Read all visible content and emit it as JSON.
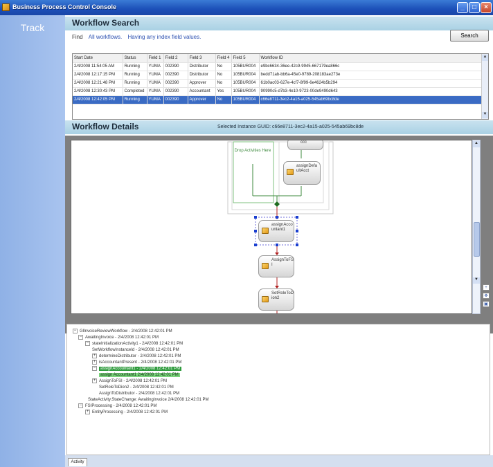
{
  "window": {
    "title": "Business Process Control Console"
  },
  "left_panel": {
    "track_label": "Track"
  },
  "search": {
    "title": "Workflow Search",
    "find_label": "Find",
    "filter_a": "All workflows.",
    "filter_b": "Having any index field values.",
    "search_button": "Search"
  },
  "grid": {
    "columns": [
      "Start Date",
      "Status",
      "Field 1",
      "Field 2",
      "Field 3",
      "Field 4",
      "Field 5",
      "Workflow ID"
    ],
    "rows": [
      [
        "2/4/2008 11:54:05 AM",
        "Running",
        "YUMA",
        "002390",
        "Distributor",
        "No",
        "105BUR004",
        "e9bc6634-36ee-42c9-9945-667179ea866c"
      ],
      [
        "2/4/2008 12:17:15 PM",
        "Running",
        "YUMA",
        "002390",
        "Distributor",
        "No",
        "105BUR004",
        "bedd71ab-bb6a-45e0-9789-208183ae273e"
      ],
      [
        "2/4/2008 12:21:48 PM",
        "Running",
        "YUMA",
        "002390",
        "Approver",
        "No",
        "105BUR004",
        "61b0ac03-627e-4cf7-8f99-6e4624b5b294"
      ],
      [
        "2/4/2008 12:30:43 PM",
        "Completed",
        "YUMA",
        "002390",
        "Accountant",
        "Yes",
        "105BUR004",
        "90990c5-d7b3-4e10-9723-00de9490d643"
      ],
      [
        "2/4/2008 12:42:05 PM",
        "Running",
        "YUMA",
        "002390",
        "Approver",
        "No",
        "105BUR004",
        "c66e8711-3ec2-4a15-a025-545ab69bc8de"
      ]
    ],
    "selected_row": 4
  },
  "details": {
    "title": "Workflow Details",
    "selected_guid": "Selected Instance GUID: c66e8711-3ec2-4a15-a025-545ab69bc8de"
  },
  "designer": {
    "drop_hint": "Drop Activities Here",
    "activities": {
      "top_partial": "ccc",
      "assign_default": "assignDefa ultAcct",
      "assign_accountant": "assignAcco untant1",
      "assign_to_fs": "AssignToFS I",
      "set_role": "SetRoleToD ion2"
    }
  },
  "tree": {
    "nodes": [
      {
        "text": "GlInvoiceReviewWorkflow - 2/4/2008 12:42:01 PM",
        "expander": "−",
        "hl": ""
      },
      {
        "text": "AwaitingInvoice - 2/4/2008 12:42:01 PM",
        "expander": "−",
        "hl": ""
      },
      {
        "text": "stateInitializationActivity1 - 2/4/2008 12:42:01 PM",
        "expander": "−",
        "hl": ""
      },
      {
        "text": "SetWorkflowInstanceId - 2/4/2008 12:42:01 PM",
        "expander": "",
        "hl": ""
      },
      {
        "text": "determineDistributor - 2/4/2008 12:42:01 PM",
        "expander": "+",
        "hl": ""
      },
      {
        "text": "isAccountantPresent - 2/4/2008 12:42:01 PM",
        "expander": "+",
        "hl": ""
      },
      {
        "text": "assignAccountant1 - 2/4/2008 12:42:01 PM",
        "expander": "−",
        "hl": "dark"
      },
      {
        "text": "assign Accountant1 2/4/2008 12:42:01 PM",
        "expander": "",
        "hl": "light"
      },
      {
        "text": "AssignToFSI - 2/4/2008 12:42:01 PM",
        "expander": "+",
        "hl": ""
      },
      {
        "text": "SetRoleToDion2 - 2/4/2008 12:42:01 PM",
        "expander": "",
        "hl": ""
      },
      {
        "text": "AssignToDistributor - 2/4/2008 12:42:01 PM",
        "expander": "",
        "hl": ""
      },
      {
        "text": "StateActivity.StateChange: AwaitingInvoice 2/4/2008 12:42:01 PM",
        "expander": "",
        "hl": ""
      },
      {
        "text": "FSIProcessing - 2/4/2008 12:42:01 PM",
        "expander": "−",
        "hl": ""
      },
      {
        "text": "EntityProcessing - 2/4/2008 12:42:01 PM",
        "expander": "+",
        "hl": ""
      }
    ]
  },
  "bottom_tab": {
    "label": "Activity"
  }
}
